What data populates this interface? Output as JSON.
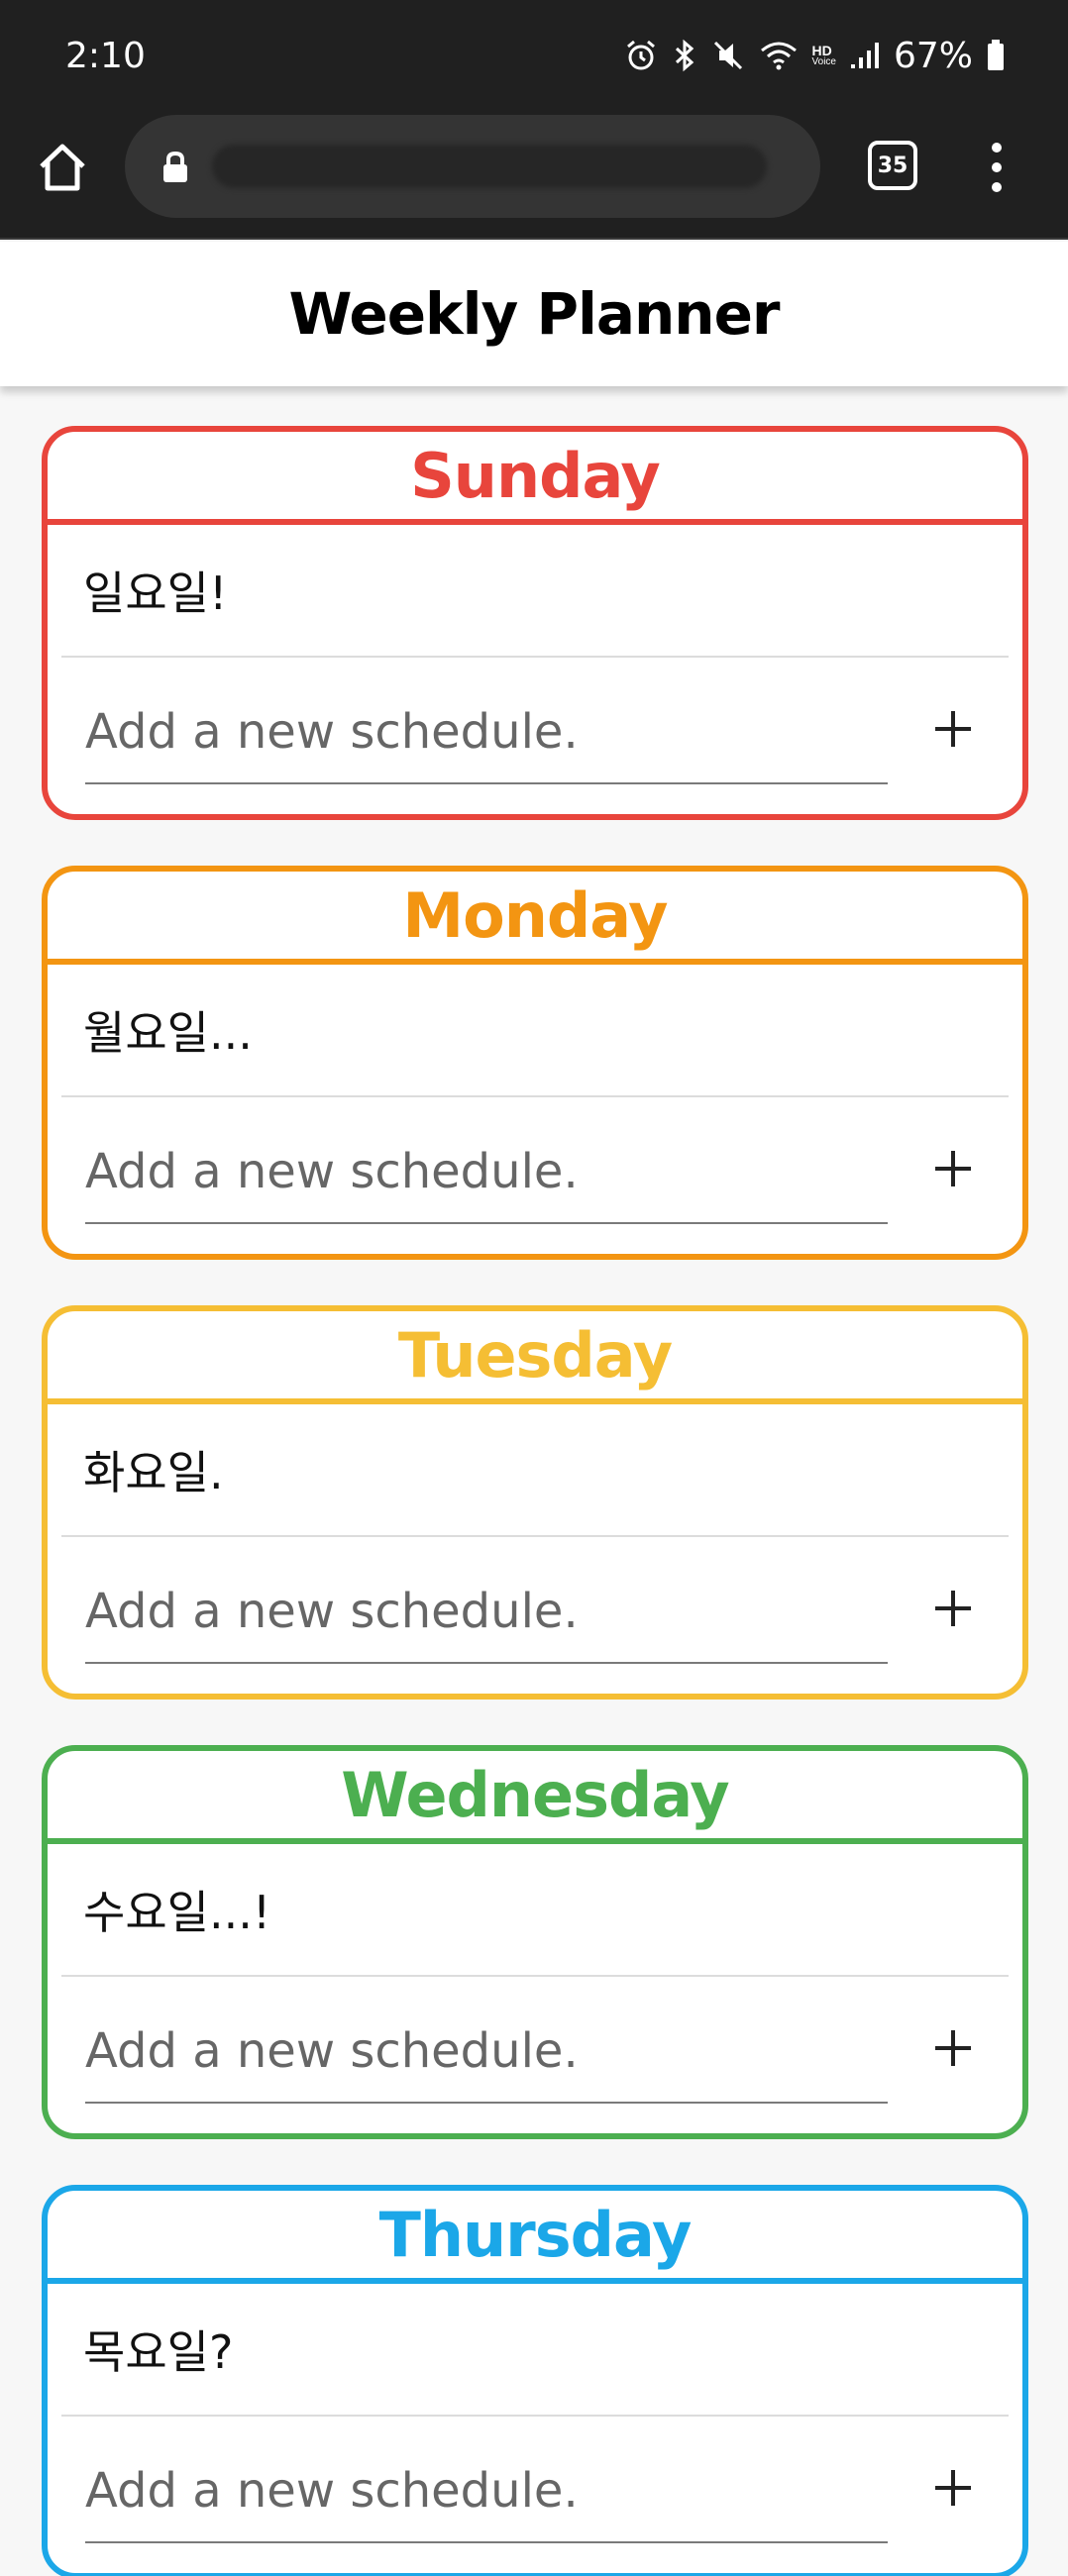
{
  "status_bar": {
    "time": "2:10",
    "battery": "67%",
    "icons": [
      "alarm-icon",
      "bluetooth-icon",
      "mute-icon",
      "wifi-icon",
      "hd-voice-icon",
      "signal-icon",
      "battery-icon"
    ],
    "hd_label": "HD",
    "voice_label": "Voice"
  },
  "browser": {
    "tab_count": "35"
  },
  "app": {
    "title": "Weekly Planner"
  },
  "days": [
    {
      "name": "Sunday",
      "color": "#e8453c",
      "schedule": "일요일!",
      "placeholder": "Add a new schedule."
    },
    {
      "name": "Monday",
      "color": "#f39512",
      "schedule": "월요일...",
      "placeholder": "Add a new schedule."
    },
    {
      "name": "Tuesday",
      "color": "#f5be34",
      "schedule": "화요일.",
      "placeholder": "Add a new schedule."
    },
    {
      "name": "Wednesday",
      "color": "#4caf50",
      "schedule": "수요일...!",
      "placeholder": "Add a new schedule."
    },
    {
      "name": "Thursday",
      "color": "#1ba7e8",
      "schedule": "목요일?",
      "placeholder": "Add a new schedule."
    }
  ]
}
